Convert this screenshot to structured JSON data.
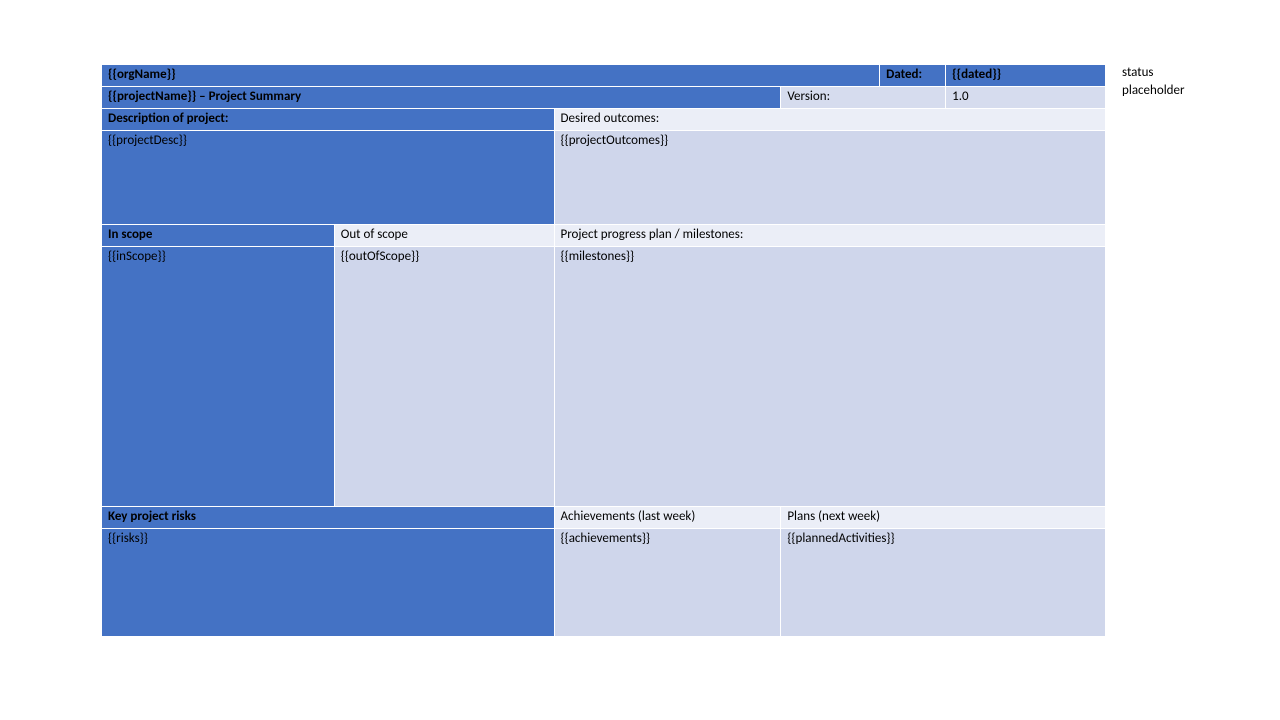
{
  "header": {
    "orgName": "{{orgName}}",
    "datedLabel": "Dated:",
    "dated": "{{dated}}",
    "projectSummary": "{{projectName}}  – Project Summary",
    "versionLabel": "Version:",
    "version": "1.0"
  },
  "section": {
    "descLabel": "Description of project:",
    "outcomesLabel": "Desired outcomes:",
    "projectDesc": "{{projectDesc}}",
    "projectOutcomes": "{{projectOutcomes}}",
    "inScopeLabel": "In scope",
    "outOfScopeLabel": "Out of scope",
    "milestonesLabel": "Project progress plan / milestones:",
    "inScope": "{{inScope}}",
    "outOfScope": "{{outOfScope}}",
    "milestones": "{{milestones}}",
    "risksLabel": "Key project risks",
    "achievementsLabel": "Achievements (last week)",
    "plansLabel": "Plans (next week)",
    "risks": "{{risks}}",
    "achievements": "{{achievements}}",
    "plannedActivities": "{{plannedActivities}}"
  },
  "side": {
    "line1": "status",
    "line2": "placeholder"
  }
}
